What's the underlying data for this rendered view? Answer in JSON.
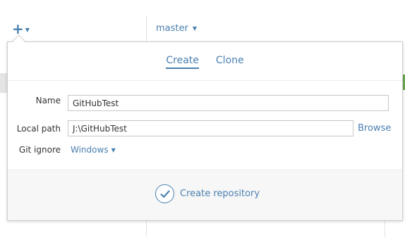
{
  "toolbar": {
    "add_icon": "plus-icon",
    "add_caret_icon": "caret-down-icon",
    "branch_label": "master",
    "branch_caret_icon": "caret-down-icon"
  },
  "popover": {
    "tabs": [
      {
        "label": "Create",
        "active": true
      },
      {
        "label": "Clone",
        "active": false
      }
    ],
    "form": {
      "name_label": "Name",
      "name_value": "GitHubTest",
      "local_path_label": "Local path",
      "local_path_value": "J:\\GitHubTest",
      "browse_label": "Browse",
      "gitignore_label": "Git ignore",
      "gitignore_value": "Windows"
    },
    "footer": {
      "create_label": "Create repository",
      "create_icon": "checkmark-circle-icon"
    }
  },
  "colors": {
    "accent": "#4a7fb0",
    "border": "#cfcfcf",
    "footer_bg": "#f7f7f7",
    "graph_green": "#6aa84f"
  }
}
